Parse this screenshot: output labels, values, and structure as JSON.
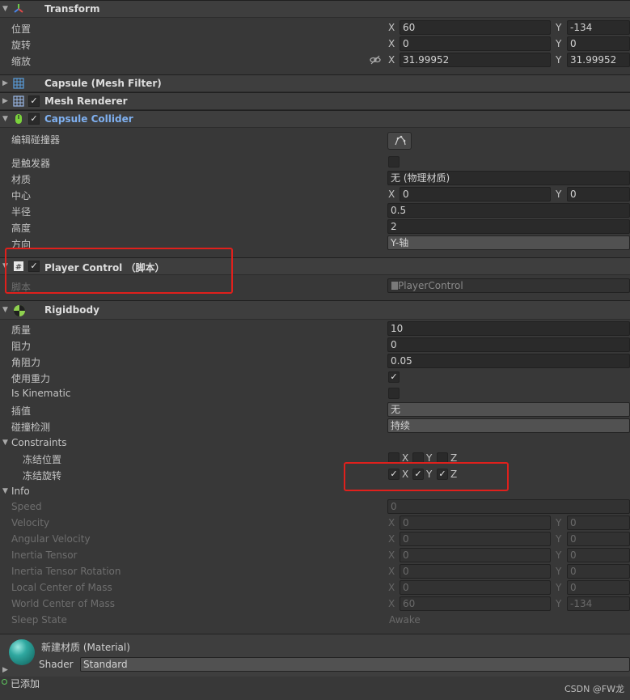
{
  "transform": {
    "title": "Transform",
    "position_label": "位置",
    "rotation_label": "旋转",
    "scale_label": "缩放",
    "position": {
      "x": "60",
      "y": "-134"
    },
    "rotation": {
      "x": "0",
      "y": "0"
    },
    "scale": {
      "x": "31.99952",
      "y": "31.99952"
    }
  },
  "axis": {
    "x": "X",
    "y": "Y",
    "z": "Z"
  },
  "mesh_filter": {
    "title": "Capsule (Mesh Filter)"
  },
  "mesh_renderer": {
    "title": "Mesh Renderer"
  },
  "capsule_collider": {
    "title": "Capsule Collider",
    "edit_label": "编辑碰撞器",
    "is_trigger_label": "是触发器",
    "material_label": "材质",
    "material_value": "无 (物理材质)",
    "center_label": "中心",
    "center": {
      "x": "0",
      "y": "0"
    },
    "radius_label": "半径",
    "radius": "0.5",
    "height_label": "高度",
    "height": "2",
    "direction_label": "方向",
    "direction": "Y-轴"
  },
  "player_control": {
    "title": "Player Control  （脚本）",
    "script_label": "脚本",
    "script_value": "PlayerControl"
  },
  "rigidbody": {
    "title": "Rigidbody",
    "mass_label": "质量",
    "mass": "10",
    "drag_label": "阻力",
    "drag": "0",
    "angular_drag_label": "角阻力",
    "angular_drag": "0.05",
    "use_gravity_label": "使用重力",
    "is_kinematic_label": "Is Kinematic",
    "interpolate_label": "插值",
    "interpolate": "无",
    "collision_label": "碰撞检测",
    "collision": "持续",
    "constraints_label": "Constraints",
    "freeze_position_label": "冻结位置",
    "freeze_rotation_label": "冻结旋转",
    "info_label": "Info",
    "speed_label": "Speed",
    "speed": "0",
    "velocity_label": "Velocity",
    "velocity": {
      "x": "0",
      "y": "0"
    },
    "angular_velocity_label": "Angular Velocity",
    "angular_velocity": {
      "x": "0",
      "y": "0"
    },
    "inertia_tensor_label": "Inertia Tensor",
    "inertia_tensor": {
      "x": "0",
      "y": "0"
    },
    "inertia_tensor_rotation_label": "Inertia Tensor Rotation",
    "inertia_tensor_rotation": {
      "x": "0",
      "y": "0"
    },
    "local_com_label": "Local Center of Mass",
    "local_com": {
      "x": "0",
      "y": "0"
    },
    "world_com_label": "World Center of Mass",
    "world_com": {
      "x": "60",
      "y": "-134"
    },
    "sleep_state_label": "Sleep State",
    "sleep_state": "Awake"
  },
  "material": {
    "title": "新建材质 (Material)",
    "shader_label": "Shader",
    "shader_value": "Standard"
  },
  "footer": {
    "added_label": "已添加",
    "watermark": "CSDN @FW龙"
  },
  "checks": {
    "check_mark": "✓"
  },
  "colors": {
    "highlight_red": "#e0201c",
    "link_blue": "#7fb0f0",
    "material_sphere": "#2fa8a0"
  }
}
